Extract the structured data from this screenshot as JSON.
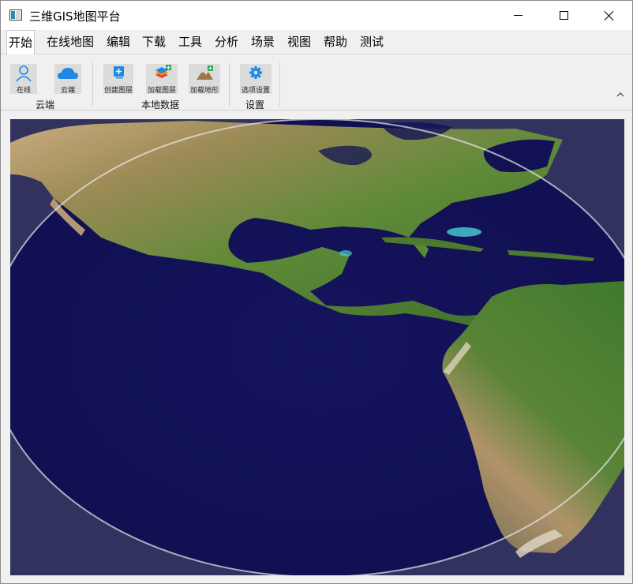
{
  "window": {
    "title": "三维GIS地图平台"
  },
  "menu": {
    "items": [
      {
        "label": "开始",
        "name": "menu-start"
      },
      {
        "label": "在线地图",
        "name": "menu-online-map"
      },
      {
        "label": "编辑",
        "name": "menu-edit"
      },
      {
        "label": "下载",
        "name": "menu-download"
      },
      {
        "label": "工具",
        "name": "menu-tools"
      },
      {
        "label": "分析",
        "name": "menu-analysis"
      },
      {
        "label": "场景",
        "name": "menu-scene"
      },
      {
        "label": "视图",
        "name": "menu-view"
      },
      {
        "label": "帮助",
        "name": "menu-help"
      },
      {
        "label": "测试",
        "name": "menu-test"
      }
    ],
    "active": "开始"
  },
  "ribbon": {
    "groups": [
      {
        "label": "云端",
        "buttons": [
          {
            "label": "在线",
            "icon": "user-icon"
          },
          {
            "label": "云端",
            "icon": "cloud-icon"
          }
        ]
      },
      {
        "label": "本地数据",
        "buttons": [
          {
            "label": "创建图层",
            "icon": "add-layer-icon"
          },
          {
            "label": "加载图层",
            "icon": "load-layers-icon"
          },
          {
            "label": "加载地形",
            "icon": "terrain-icon"
          }
        ]
      },
      {
        "label": "设置",
        "buttons": [
          {
            "label": "选项设置",
            "icon": "gear-icon"
          }
        ]
      }
    ]
  },
  "colors": {
    "ocean": "#121154",
    "space": "#32325e",
    "land_green": "#4d7a2f",
    "land_desert": "#b79a6a",
    "accent_blue": "#1e88e5",
    "accent_green": "#2ea44f"
  }
}
